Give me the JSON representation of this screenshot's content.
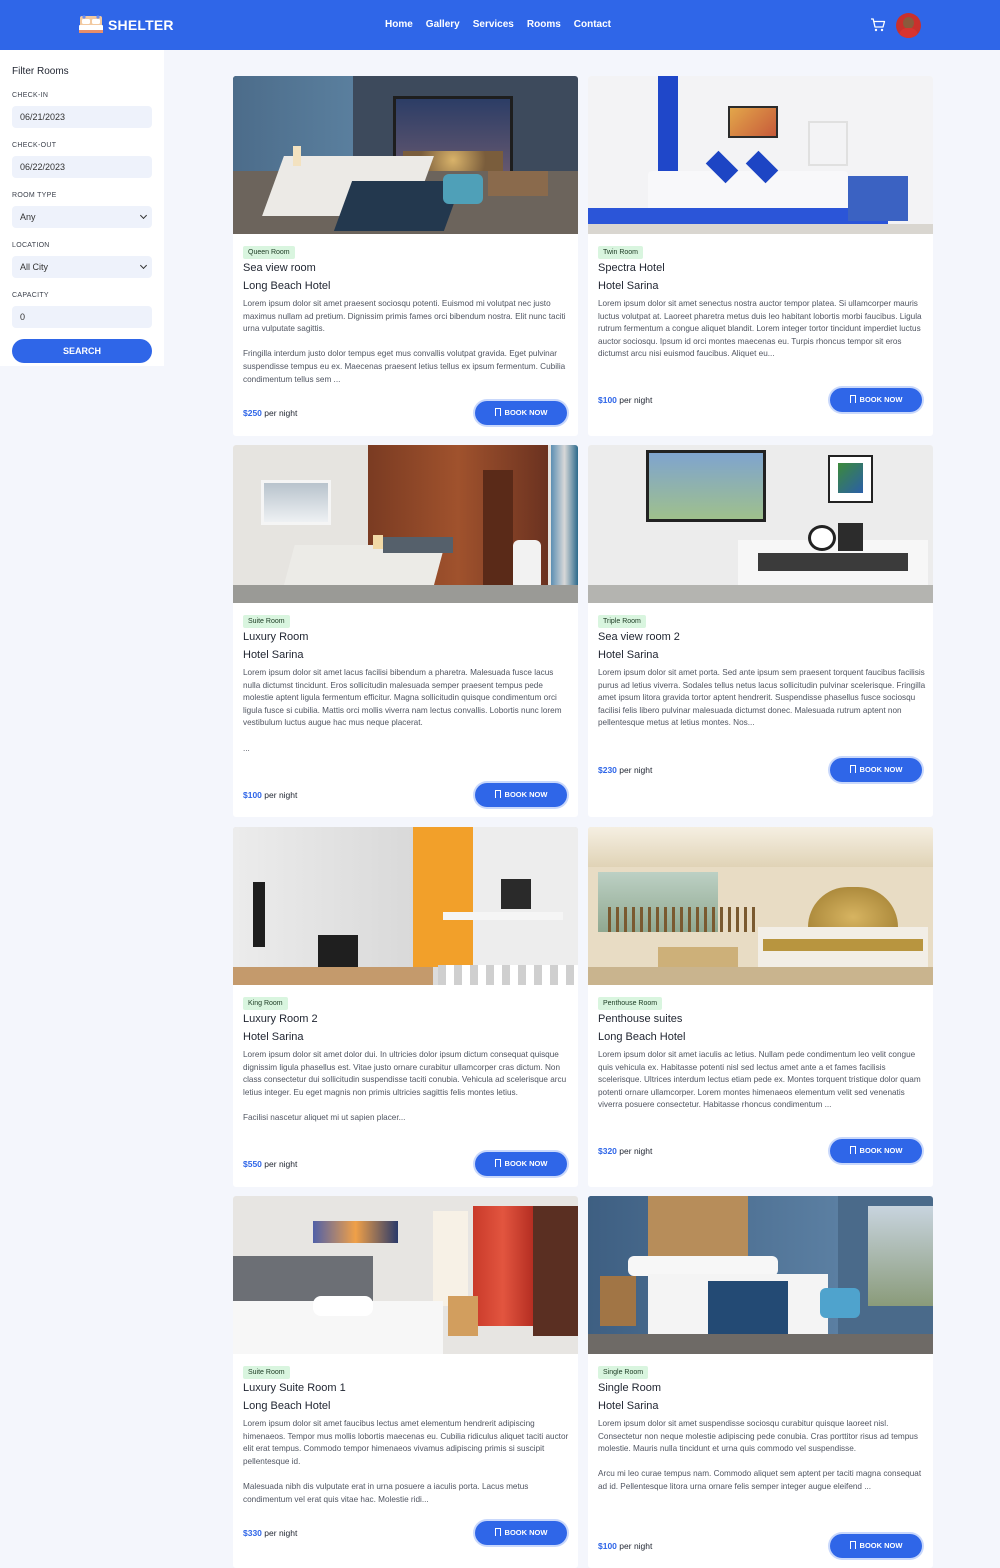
{
  "brand": {
    "name": "SHELTER"
  },
  "nav": [
    "Home",
    "Gallery",
    "Services",
    "Rooms",
    "Contact"
  ],
  "header": {
    "cart_icon": "cart-icon",
    "avatar": "user-avatar"
  },
  "filters": {
    "title": "Filter Rooms",
    "checkin_label": "CHECK-IN",
    "checkin_value": "06/21/2023",
    "checkout_label": "CHECK-OUT",
    "checkout_value": "06/22/2023",
    "room_type_label": "ROOM TYPE",
    "room_type_value": "Any",
    "location_label": "LOCATION",
    "location_value": "All City",
    "capacity_label": "CAPACITY",
    "capacity_value": "0",
    "search_label": "SEARCH"
  },
  "per_night": "per night",
  "book_label": "BOOK NOW",
  "rooms": [
    {
      "type": "Queen Room",
      "name": "Sea view room",
      "hotel": "Long Beach Hotel",
      "price": "$250",
      "desc": "Lorem ipsum dolor sit amet praesent sociosqu potenti. Euismod mi volutpat nec justo maximus nullam ad pretium. Dignissim primis fames orci bibendum nostra. Elit nunc taciti urna vulputate sagittis.\n\nFringilla interdum justo dolor tempus eget mus convallis volutpat gravida. Eget pulvinar suspendisse tempus eu ex. Maecenas praesent letius tellus ex ipsum fermentum. Cubilia condimentum tellus sem ..."
    },
    {
      "type": "Twin Room",
      "name": "Spectra Hotel",
      "hotel": "Hotel Sarina",
      "price": "$100",
      "desc": "Lorem ipsum dolor sit amet senectus nostra auctor tempor platea. Si ullamcorper mauris luctus volutpat at. Laoreet pharetra metus duis leo habitant lobortis morbi faucibus. Ligula rutrum fermentum a congue aliquet blandit. Lorem integer tortor tincidunt imperdiet luctus auctor sociosqu. Ipsum id orci montes maecenas eu. Turpis rhoncus tempor sit eros dictumst arcu nisi euismod faucibus. Aliquet eu..."
    },
    {
      "type": "Suite Room",
      "name": "Luxury Room",
      "hotel": "Hotel Sarina",
      "price": "$100",
      "desc": "Lorem ipsum dolor sit amet lacus facilisi bibendum a pharetra. Malesuada fusce lacus nulla dictumst tincidunt. Eros sollicitudin malesuada semper praesent tempus pede molestie aptent ligula fermentum efficitur. Magna sollicitudin quisque condimentum orci ligula fusce si cubilia. Mattis orci mollis viverra nam lectus convallis. Lobortis nunc lorem vestibulum luctus augue hac mus neque placerat.\n\n..."
    },
    {
      "type": "Triple Room",
      "name": "Sea view room 2",
      "hotel": "Hotel Sarina",
      "price": "$230",
      "desc": "Lorem ipsum dolor sit amet porta. Sed ante ipsum sem praesent torquent faucibus facilisis purus ad letius viverra. Sodales tellus netus lacus sollicitudin pulvinar scelerisque. Fringilla amet ipsum litora gravida tortor aptent hendrerit. Suspendisse phasellus fusce sociosqu facilisi felis libero pulvinar malesuada dictumst donec. Malesuada rutrum aptent non pellentesque metus at letius montes. Nos..."
    },
    {
      "type": "King Room",
      "name": "Luxury Room 2",
      "hotel": "Hotel Sarina",
      "price": "$550",
      "desc": "Lorem ipsum dolor sit amet dolor dui. In ultricies dolor ipsum dictum consequat quisque dignissim ligula phasellus est. Vitae justo ornare curabitur ullamcorper cras dictum. Non class consectetur dui sollicitudin suspendisse taciti conubia. Vehicula ad scelerisque arcu letius integer. Eu eget magnis non primis ultricies sagittis felis montes letius.\n\nFacilisi nascetur aliquet mi ut sapien placer..."
    },
    {
      "type": "Penthouse Room",
      "name": "Penthouse suites",
      "hotel": "Long Beach Hotel",
      "price": "$320",
      "desc": "Lorem ipsum dolor sit amet iaculis ac letius. Nullam pede condimentum leo velit congue quis vehicula ex. Habitasse potenti nisl sed lectus amet ante a et fames facilisis scelerisque. Ultrices interdum lectus etiam pede ex. Montes torquent tristique dolor quam potenti ornare ullamcorper. Lorem montes himenaeos elementum velit sed venenatis viverra posuere consectetur. Habitasse rhoncus condimentum ..."
    },
    {
      "type": "Suite Room",
      "name": "Luxury Suite Room 1",
      "hotel": "Long Beach Hotel",
      "price": "$330",
      "desc": "Lorem ipsum dolor sit amet faucibus lectus amet elementum hendrerit adipiscing himenaeos. Tempor mus mollis lobortis maecenas eu. Cubilia ridiculus aliquet taciti auctor elit erat tempus. Commodo tempor himenaeos vivamus adipiscing primis si suscipit pellentesque id.\n\nMalesuada nibh dis vulputate erat in urna posuere a iaculis porta. Lacus metus condimentum vel erat quis vitae hac. Molestie ridi..."
    },
    {
      "type": "Single Room",
      "name": "Single Room",
      "hotel": "Hotel Sarina",
      "price": "$100",
      "desc": "Lorem ipsum dolor sit amet suspendisse sociosqu curabitur quisque laoreet nisl. Consectetur non neque molestie adipiscing pede conubia. Cras porttitor risus ad tempus molestie. Mauris nulla tincidunt et urna quis commodo vel suspendisse.\n\nArcu mi leo curae tempus nam. Commodo aliquet sem aptent per taciti magna consequat ad id. Pellentesque litora urna ornare felis semper integer augue eleifend ..."
    }
  ]
}
